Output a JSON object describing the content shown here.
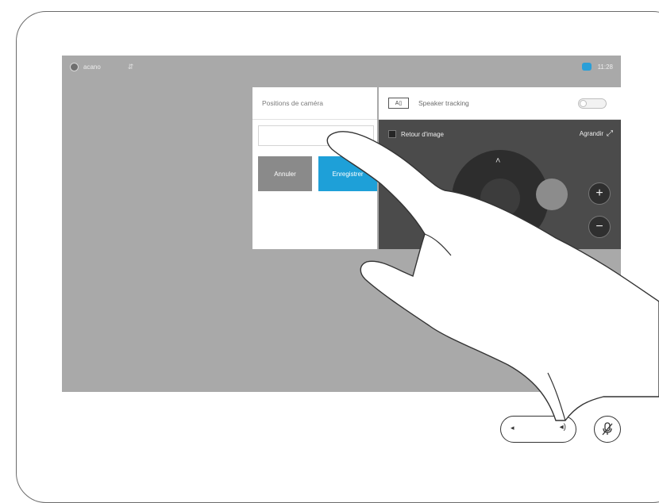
{
  "status_bar": {
    "contact_icon": "status-icon",
    "contact_label": "acano",
    "signal_icon": "signal-icon",
    "self_view_icon": "camera-self-view-icon",
    "time": "11:28"
  },
  "camera_panel": {
    "presets_title": "Positions de caméra",
    "preset_name_value": "",
    "cancel_label": "Annuler",
    "save_label": "Enregistrer",
    "speaker_tracking_icon": "speaker-track-icon",
    "speaker_tracking_label": "Speaker tracking",
    "speaker_tracking_on": false,
    "mirror_label": "Retour d'image",
    "mirror_checked": true,
    "expand_label": "Agrandir",
    "zoom_in": "+",
    "zoom_out": "−"
  },
  "bottom_controls": {
    "volume_low_icon": "speaker-low-icon",
    "volume_high_icon": "speaker-high-icon",
    "mute_icon": "microphone-muted-icon"
  },
  "colors": {
    "screen_bg": "#a9a9a9",
    "accent": "#1ea0d8",
    "cancel": "#8a8a8a",
    "dark_pane": "#4b4b4b"
  }
}
